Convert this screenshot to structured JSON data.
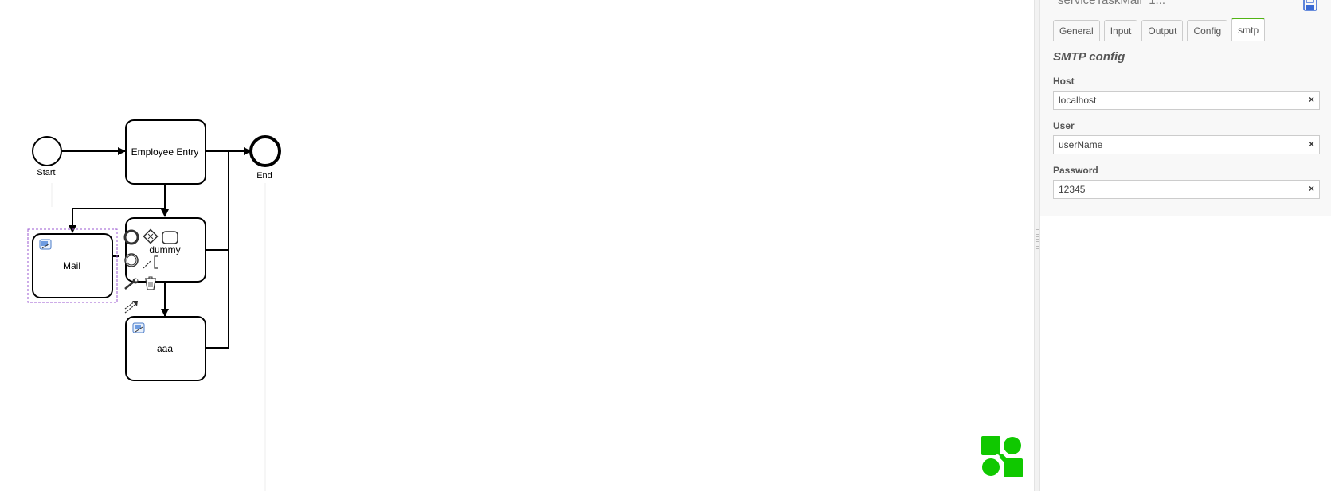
{
  "diagram": {
    "start_label": "Start",
    "end_label": "End",
    "task_employee_entry": "Employee Entry",
    "task_dummy": "dummy",
    "task_mail": "Mail",
    "task_aaa": "aaa"
  },
  "panel": {
    "title": "serviceTaskMail_1...",
    "tabs": [
      "General",
      "Input",
      "Output",
      "Config",
      "smtp"
    ],
    "active_tab": "smtp",
    "group_title": "SMTP config",
    "fields": [
      {
        "label": "Host",
        "value": "localhost"
      },
      {
        "label": "User",
        "value": "userName"
      },
      {
        "label": "Password",
        "value": "12345"
      }
    ],
    "clear_symbol": "×"
  },
  "colors": {
    "tab_active_border": "#52b415",
    "logo_green": "#10c800",
    "selection_outline": "#9b59d0",
    "save_icon": "#3a6ad4"
  },
  "icons": [
    "save-icon",
    "service-task-icon",
    "context-pad-icons",
    "bpmn-logo-icon"
  ]
}
